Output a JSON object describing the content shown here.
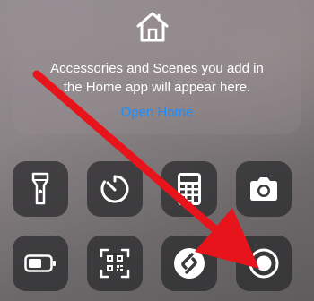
{
  "home": {
    "message_line1": "Accessories and Scenes you add in",
    "message_line2": "the Home app will appear here.",
    "link_label": "Open Home",
    "link_color": "#1a8fff"
  },
  "controls": [
    {
      "name": "flashlight-icon"
    },
    {
      "name": "timer-icon"
    },
    {
      "name": "calculator-icon"
    },
    {
      "name": "camera-icon"
    },
    {
      "name": "battery-icon"
    },
    {
      "name": "qr-code-scanner-icon"
    },
    {
      "name": "shazam-icon"
    },
    {
      "name": "screen-recording-icon"
    }
  ],
  "annotation": {
    "color": "#e8141b",
    "shape": "arrow"
  }
}
